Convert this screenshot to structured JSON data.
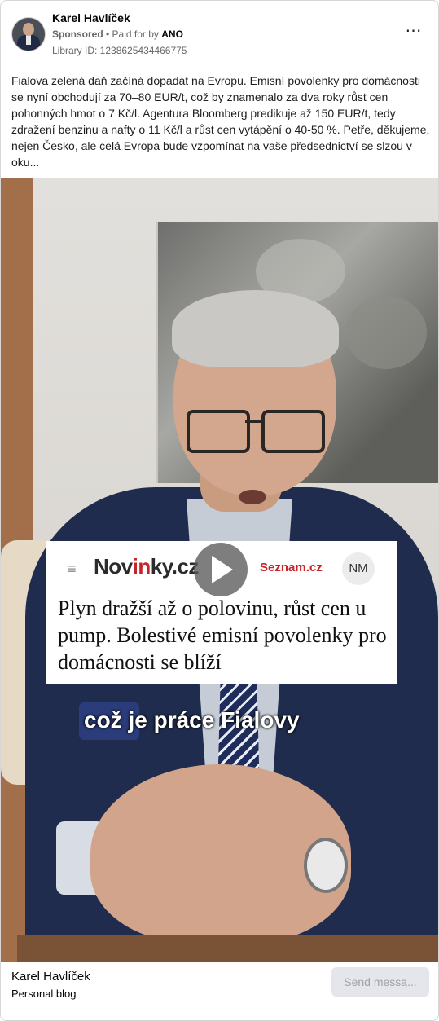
{
  "post": {
    "author": "Karel Havlíček",
    "sponsored_label": "Sponsored",
    "paid_for_prefix": "• Paid for by",
    "paid_for_name": "ANO",
    "library_id": "Library ID: 1238625434466775",
    "more_icon": "⋯",
    "text": "Fialova zelená daň začíná dopadat na Evropu. Emisní povolenky pro domácnosti se nyní obchodují za 70–80 EUR/t, což by znamenalo za dva roky růst cen pohonných hmot o 7 Kč/l. Agentura Bloomberg predikuje až 150 EUR/t, tedy zdražení benzinu a nafty o 11 Kč/l a růst cen vytápění o 40-50 %. Petře, děkujeme, nejen Česko, ale celá Evropa bude vzpomínat na vaše předsednictví se slzou v oku..."
  },
  "video": {
    "news_logo_a": "Nov",
    "news_logo_b": "in",
    "news_logo_c": "ky.cz",
    "news_brand": "Seznam.cz",
    "news_avatar": "NM",
    "news_headline": "Plyn dražší až o polovinu, růst cen u pump. Bolestivé emisní povolenky pro domácnosti se blíží",
    "caption": "což je práce Fialovy",
    "play_icon": "play-icon"
  },
  "footer": {
    "name": "Karel Havlíček",
    "subtitle": "Personal blog",
    "button_label": "Send messa..."
  }
}
